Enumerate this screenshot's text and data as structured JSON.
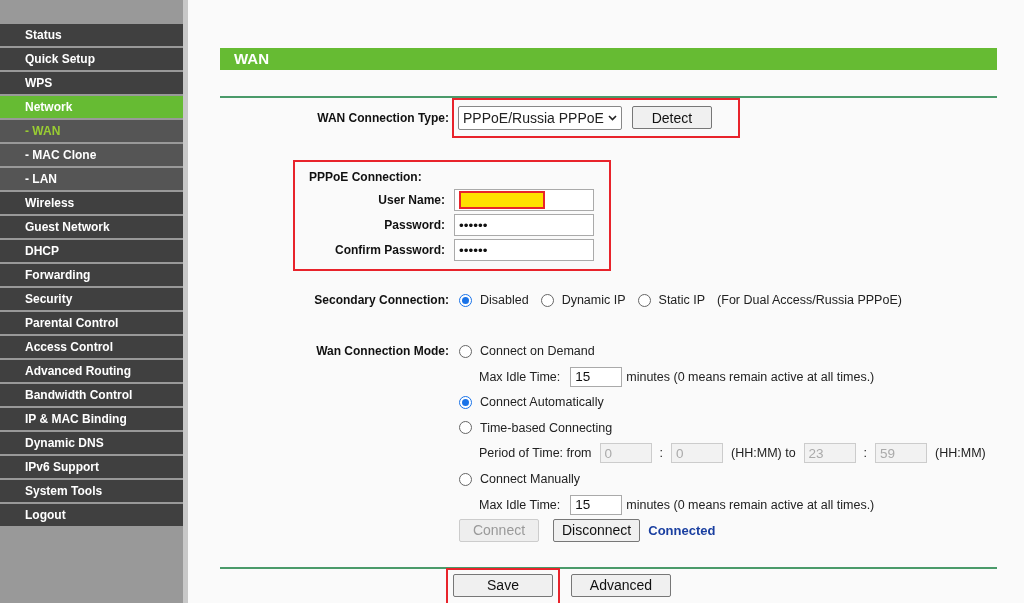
{
  "sidebar": {
    "items": [
      {
        "label": "Status",
        "kind": "main",
        "selected": false
      },
      {
        "label": "Quick Setup",
        "kind": "main",
        "selected": false
      },
      {
        "label": "WPS",
        "kind": "main",
        "selected": false
      },
      {
        "label": "Network",
        "kind": "main",
        "selected": true
      },
      {
        "label": "- WAN",
        "kind": "sub",
        "selected": true
      },
      {
        "label": "- MAC Clone",
        "kind": "sub",
        "selected": false
      },
      {
        "label": "- LAN",
        "kind": "sub",
        "selected": false
      },
      {
        "label": "Wireless",
        "kind": "main",
        "selected": false
      },
      {
        "label": "Guest Network",
        "kind": "main",
        "selected": false
      },
      {
        "label": "DHCP",
        "kind": "main",
        "selected": false
      },
      {
        "label": "Forwarding",
        "kind": "main",
        "selected": false
      },
      {
        "label": "Security",
        "kind": "main",
        "selected": false
      },
      {
        "label": "Parental Control",
        "kind": "main",
        "selected": false
      },
      {
        "label": "Access Control",
        "kind": "main",
        "selected": false
      },
      {
        "label": "Advanced Routing",
        "kind": "main",
        "selected": false
      },
      {
        "label": "Bandwidth Control",
        "kind": "main",
        "selected": false
      },
      {
        "label": "IP & MAC Binding",
        "kind": "main",
        "selected": false
      },
      {
        "label": "Dynamic DNS",
        "kind": "main",
        "selected": false
      },
      {
        "label": "IPv6 Support",
        "kind": "main",
        "selected": false
      },
      {
        "label": "System Tools",
        "kind": "main",
        "selected": false
      },
      {
        "label": "Logout",
        "kind": "main",
        "selected": false
      }
    ]
  },
  "section_title": "WAN",
  "connection_type": {
    "label": "WAN Connection Type:",
    "value": "PPPoE/Russia PPPoE",
    "button": "Detect",
    "highlighted": true
  },
  "pppoe": {
    "title": "PPPoE Connection:",
    "highlighted": true,
    "fields": [
      {
        "label": "User Name:",
        "redacted": true
      },
      {
        "label": "Password:",
        "value": "••••••",
        "redacted": false
      },
      {
        "label": "Confirm Password:",
        "value": "••••••",
        "redacted": false
      }
    ]
  },
  "secondary": {
    "label": "Secondary Connection:",
    "options": [
      {
        "label": "Disabled",
        "selected": true
      },
      {
        "label": "Dynamic IP",
        "selected": false
      },
      {
        "label": "Static IP",
        "selected": false
      }
    ],
    "note": "(For Dual Access/Russia PPPoE)"
  },
  "mode": {
    "label": "Wan Connection Mode:",
    "items": [
      {
        "kind": "radio",
        "label": "Connect on Demand",
        "selected": false
      },
      {
        "kind": "idle",
        "label": "Max Idle Time:",
        "value": "15",
        "note": "minutes (0 means remain active at all times.)"
      },
      {
        "kind": "radio",
        "label": "Connect Automatically",
        "selected": true
      },
      {
        "kind": "radio",
        "label": "Time-based Connecting",
        "selected": false
      },
      {
        "kind": "period",
        "label": "Period of Time: from",
        "start_h": "0",
        "start_sep": ":",
        "start_m": "0",
        "mid": "(HH:MM) to",
        "end_h": "23",
        "end_sep": ":",
        "end_m": "59",
        "end": "(HH:MM)",
        "disabled": true
      },
      {
        "kind": "radio",
        "label": "Connect Manually",
        "selected": false
      },
      {
        "kind": "idle",
        "label": "Max Idle Time:",
        "value": "15",
        "note": "minutes (0 means remain active at all times.)"
      },
      {
        "kind": "actions",
        "buttons": [
          {
            "label": "Connect",
            "disabled": true
          },
          {
            "label": "Disconnect",
            "disabled": false
          }
        ],
        "status": "Connected"
      }
    ]
  },
  "footer": {
    "buttons": [
      {
        "label": "Save",
        "highlighted": true
      },
      {
        "label": "Advanced",
        "highlighted": false
      }
    ]
  }
}
